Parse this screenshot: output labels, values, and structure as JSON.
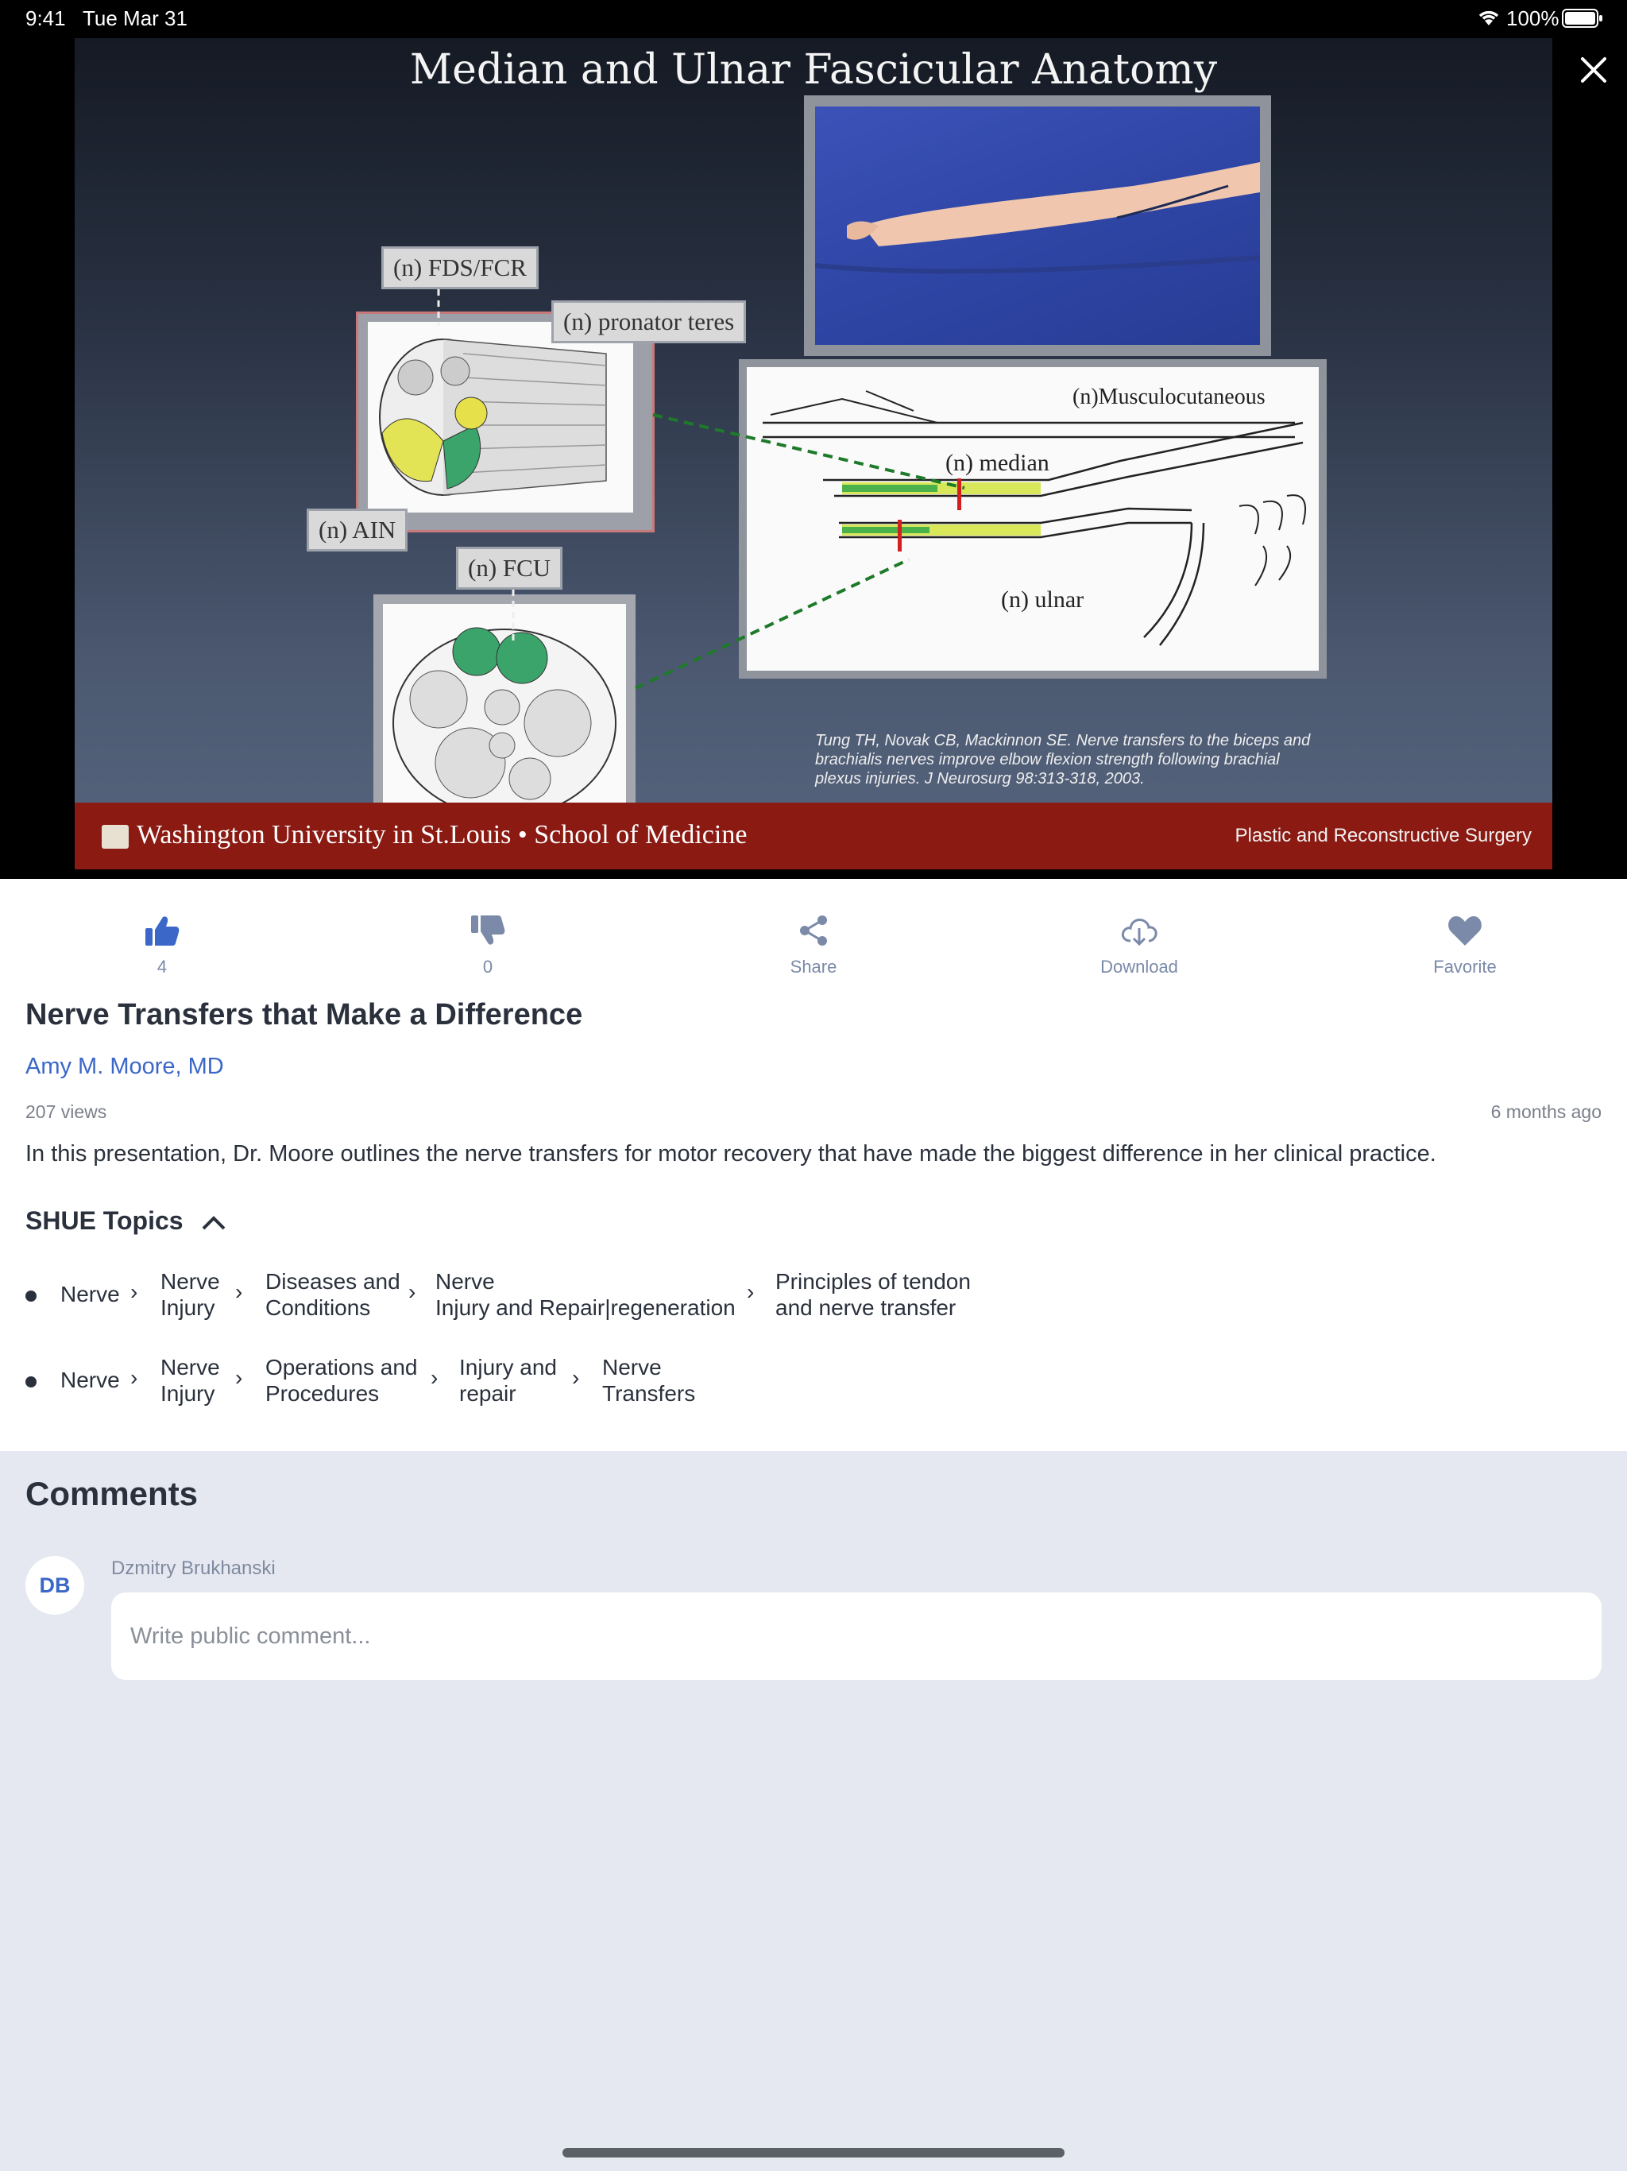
{
  "status_bar": {
    "time": "9:41",
    "date": "Tue Mar 31",
    "battery": "100%"
  },
  "slide": {
    "title": "Median and Ulnar Fascicular Anatomy",
    "labels": {
      "fds_fcr": "(n) FDS/FCR",
      "pronator": "(n) pronator teres",
      "ain": "(n) AIN",
      "fcu": "(n) FCU",
      "musculocutaneous": "(n)Musculocutaneous",
      "median": "(n) median",
      "ulnar": "(n) ulnar"
    },
    "citation": "Tung TH, Novak CB, Mackinnon SE. Nerve transfers to the biceps and brachialis nerves improve elbow flexion strength following brachial plexus injuries. J Neurosurg 98:313-318, 2003.",
    "footer_left": "Washington University in St.Louis • School of Medicine",
    "footer_right": "Plastic and Reconstructive Surgery"
  },
  "actions": {
    "likes": "4",
    "dislikes": "0",
    "share": "Share",
    "download": "Download",
    "favorite": "Favorite"
  },
  "video": {
    "title": "Nerve Transfers that Make a Difference",
    "author": "Amy M. Moore, MD",
    "views": "207 views",
    "posted": "6 months ago",
    "description": "In this presentation, Dr. Moore outlines the nerve transfers for motor recovery that have made the biggest difference in her clinical practice."
  },
  "topics": {
    "heading": "SHUE Topics",
    "rows": [
      [
        "Nerve",
        "Nerve\nInjury",
        "Diseases and\nConditions",
        "Nerve\nInjury and Repair|regeneration",
        "Principles of tendon\nand nerve transfer"
      ],
      [
        "Nerve",
        "Nerve\nInjury",
        "Operations and\nProcedures",
        "Injury and\nrepair",
        "Nerve\nTransfers"
      ]
    ]
  },
  "comments": {
    "heading": "Comments",
    "avatar_initials": "DB",
    "user_name": "Dzmitry Brukhanski",
    "placeholder": "Write public comment..."
  },
  "colors": {
    "accent": "#3a67c8",
    "icon": "#7a8aa8",
    "footer_red": "#8a1a12"
  }
}
